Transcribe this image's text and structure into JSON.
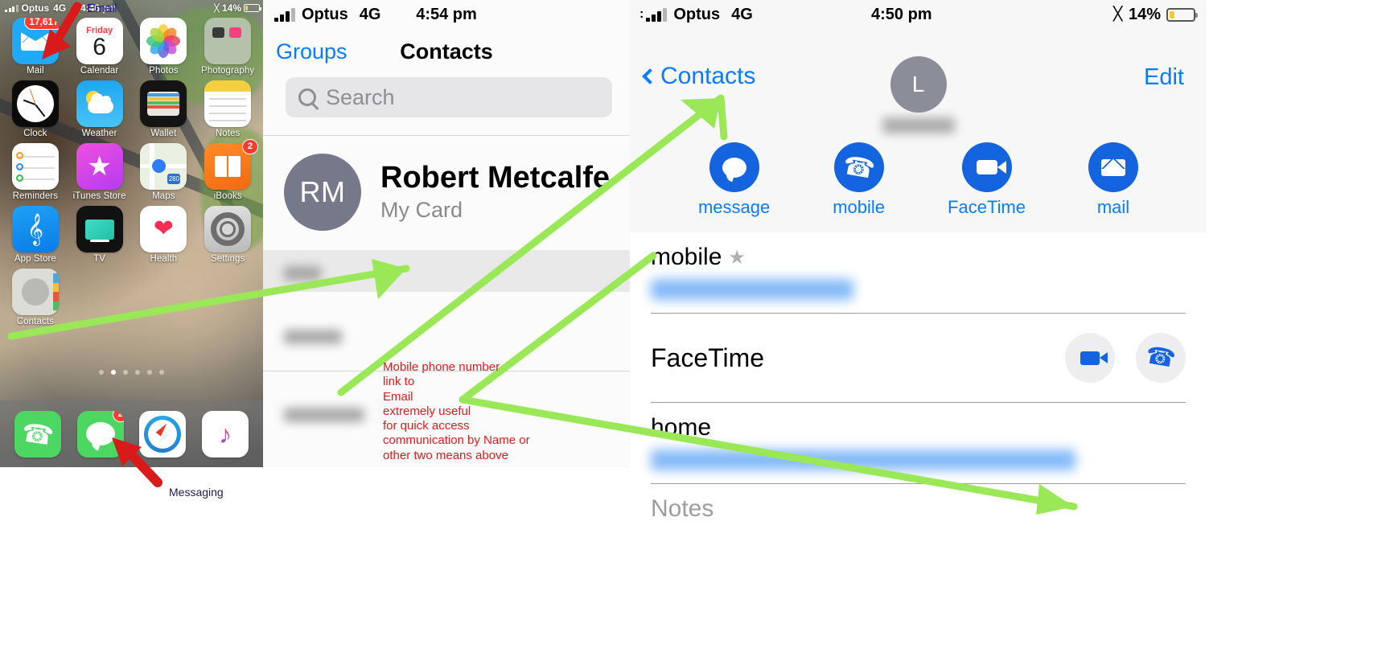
{
  "home": {
    "status": {
      "carrier": "Optus",
      "network": "4G",
      "time": "4:46 pm",
      "battery": "14%"
    },
    "apps": [
      {
        "label": "Mail",
        "icon": "mail-icon",
        "badge": "17,617"
      },
      {
        "label": "Calendar",
        "icon": "calendar-icon",
        "day": "Friday",
        "date": "6"
      },
      {
        "label": "Photos",
        "icon": "photos-icon"
      },
      {
        "label": "Photography",
        "icon": "photography-folder-icon"
      },
      {
        "label": "Clock",
        "icon": "clock-icon"
      },
      {
        "label": "Weather",
        "icon": "weather-icon"
      },
      {
        "label": "Wallet",
        "icon": "wallet-icon"
      },
      {
        "label": "Notes",
        "icon": "notes-icon"
      },
      {
        "label": "Reminders",
        "icon": "reminders-icon"
      },
      {
        "label": "iTunes Store",
        "icon": "itunes-store-icon"
      },
      {
        "label": "Maps",
        "icon": "maps-icon",
        "shield": "280"
      },
      {
        "label": "iBooks",
        "icon": "ibooks-icon",
        "badge": "2"
      },
      {
        "label": "App Store",
        "icon": "app-store-icon"
      },
      {
        "label": "TV",
        "icon": "tv-icon"
      },
      {
        "label": "Health",
        "icon": "health-icon"
      },
      {
        "label": "Settings",
        "icon": "settings-icon"
      },
      {
        "label": "Contacts",
        "icon": "contacts-icon"
      }
    ],
    "dock": [
      {
        "label": "Phone",
        "icon": "phone-icon"
      },
      {
        "label": "Messages",
        "icon": "messages-icon",
        "badge": "2"
      },
      {
        "label": "Safari",
        "icon": "safari-icon"
      },
      {
        "label": "Music",
        "icon": "music-icon"
      }
    ],
    "page_dots": {
      "count": 6,
      "active_index": 1
    }
  },
  "contacts_list": {
    "status": {
      "carrier": "Optus",
      "network": "4G",
      "time": "4:54 pm"
    },
    "nav": {
      "left": "Groups",
      "title": "Contacts"
    },
    "search": {
      "placeholder": "Search",
      "value": "",
      "icon": "search-icon"
    },
    "my_card": {
      "initials": "RM",
      "name": "Robert Metcalfe",
      "subtitle": "My Card"
    }
  },
  "contact_detail": {
    "status": {
      "carrier": "Optus",
      "network": "4G",
      "time": "4:50 pm",
      "battery": "14%",
      "bluetooth": "bluetooth-icon"
    },
    "nav": {
      "back": "Contacts",
      "edit": "Edit"
    },
    "avatar": {
      "initial": "L"
    },
    "actions": [
      {
        "label": "message",
        "icon": "message-bubble-icon"
      },
      {
        "label": "mobile",
        "icon": "phone-icon"
      },
      {
        "label": "FaceTime",
        "icon": "video-camera-icon"
      },
      {
        "label": "mail",
        "icon": "envelope-icon"
      }
    ],
    "fields": [
      {
        "label": "mobile",
        "starred": true,
        "value_hidden": true
      },
      {
        "label": "FaceTime",
        "buttons": [
          "video-camera-icon",
          "phone-icon"
        ]
      },
      {
        "label": "home",
        "value_hidden": true
      },
      {
        "label": "Notes",
        "muted": true
      }
    ]
  },
  "annotations": {
    "email_callout": "Email",
    "messaging_callout": "Messaging",
    "note": "Mobile phone number\nlink to\nEmail\nextremely useful\nfor quick access\ncommunication by Name or\nother two means above"
  }
}
